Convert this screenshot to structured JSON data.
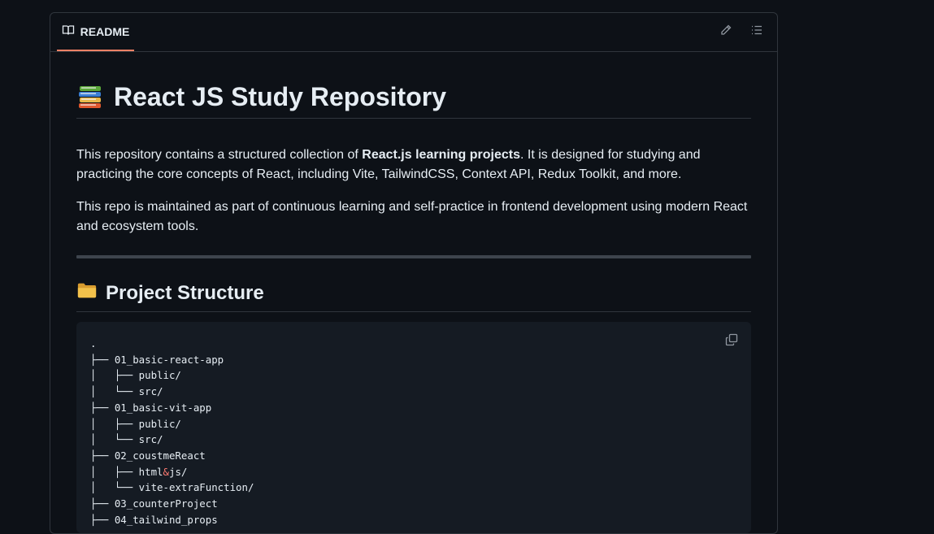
{
  "readme_tab": {
    "label": "README"
  },
  "header_actions": {
    "edit": "pencil-icon",
    "toc": "list-icon"
  },
  "title": "React JS Study Repository",
  "intro": {
    "before_bold": "This repository contains a structured collection of ",
    "bold": "React.js learning projects",
    "after_bold": ". It is designed for studying and practicing the core concepts of React, including Vite, TailwindCSS, Context API, Redux Toolkit, and more."
  },
  "para2": "This repo is maintained as part of continuous learning and self-practice in frontend development using modern React and ecosystem tools.",
  "section_title": "Project Structure",
  "tree_lines": [
    ".",
    "├── 01_basic-react-app",
    "│   ├── public/",
    "│   └── src/",
    "├── 01_basic-vit-app",
    "│   ├── public/",
    "│   └── src/",
    "├── 02_coustmeReact",
    "│   ├── html",
    "│   └── vite-extraFunction/",
    "├── 03_counterProject",
    "├── 04_tailwind_props"
  ],
  "tree_special": {
    "html_amp": "&",
    "html_js": "js/"
  },
  "colors": {
    "accent": "#f78166",
    "bg": "#0d1117",
    "code_bg": "#151b23",
    "border": "#30363d"
  }
}
